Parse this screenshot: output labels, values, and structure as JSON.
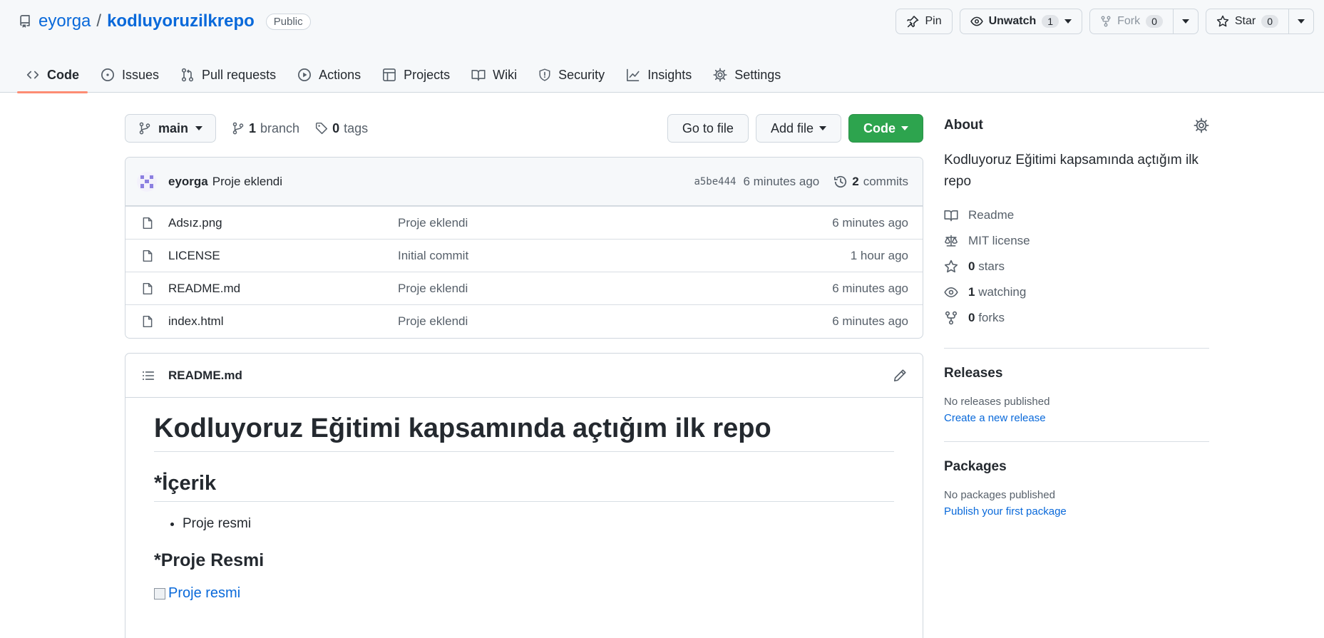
{
  "repo": {
    "owner": "eyorga",
    "separator": "/",
    "name": "kodluyoruzilkrepo",
    "visibility": "Public"
  },
  "header_actions": {
    "pin": "Pin",
    "unwatch": "Unwatch",
    "watch_count": "1",
    "fork": "Fork",
    "fork_count": "0",
    "star": "Star",
    "star_count": "0"
  },
  "tabs": [
    {
      "label": "Code",
      "icon": "code-icon",
      "active": true
    },
    {
      "label": "Issues",
      "icon": "issue-icon"
    },
    {
      "label": "Pull requests",
      "icon": "pull-request-icon"
    },
    {
      "label": "Actions",
      "icon": "play-icon"
    },
    {
      "label": "Projects",
      "icon": "table-icon"
    },
    {
      "label": "Wiki",
      "icon": "book-icon"
    },
    {
      "label": "Security",
      "icon": "shield-icon"
    },
    {
      "label": "Insights",
      "icon": "graph-icon"
    },
    {
      "label": "Settings",
      "icon": "gear-icon"
    }
  ],
  "branch_bar": {
    "branch": "main",
    "branch_count": "1",
    "branch_label": "branch",
    "tag_count": "0",
    "tag_label": "tags",
    "go_to_file": "Go to file",
    "add_file": "Add file",
    "code": "Code"
  },
  "latest_commit": {
    "author": "eyorga",
    "message": "Proje eklendi",
    "sha": "a5be444",
    "time": "6 minutes ago",
    "commit_count": "2",
    "commit_label": "commits"
  },
  "files": [
    {
      "name": "Adsız.png",
      "message": "Proje eklendi",
      "time": "6 minutes ago"
    },
    {
      "name": "LICENSE",
      "message": "Initial commit",
      "time": "1 hour ago"
    },
    {
      "name": "README.md",
      "message": "Proje eklendi",
      "time": "6 minutes ago"
    },
    {
      "name": "index.html",
      "message": "Proje eklendi",
      "time": "6 minutes ago"
    }
  ],
  "readme": {
    "filename": "README.md",
    "h1": "Kodluyoruz Eğitimi kapsamında açtığım ilk repo",
    "h2": "*İçerik",
    "list_item": "Proje resmi",
    "h3": "*Proje Resmi",
    "image_alt": "Proje resmi"
  },
  "about": {
    "title": "About",
    "description": "Kodluyoruz Eğitimi kapsamında açtığım ilk repo",
    "readme": "Readme",
    "license": "MIT license",
    "stars_count": "0",
    "stars_label": "stars",
    "watching_count": "1",
    "watching_label": "watching",
    "forks_count": "0",
    "forks_label": "forks"
  },
  "releases": {
    "title": "Releases",
    "empty": "No releases published",
    "link": "Create a new release"
  },
  "packages": {
    "title": "Packages",
    "empty": "No packages published",
    "link": "Publish your first package"
  },
  "colors": {
    "link": "#0969da",
    "active_tab_underline": "#fd8c73",
    "code_button": "#2da44e"
  }
}
